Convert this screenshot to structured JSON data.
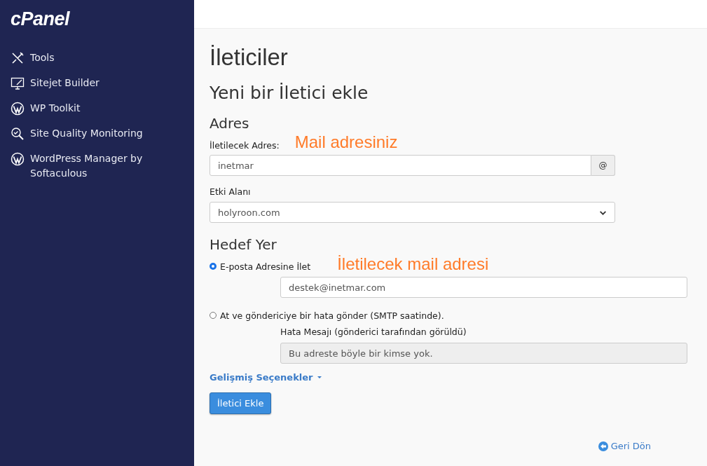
{
  "sidebar": {
    "logo": "cPanel",
    "items": [
      {
        "label": "Tools",
        "kind": "tools"
      },
      {
        "label": "Sitejet Builder",
        "kind": "builder"
      },
      {
        "label": "WP Toolkit",
        "kind": "wordpress"
      },
      {
        "label": "Site Quality Monitoring",
        "kind": "monitoring"
      },
      {
        "label": "WordPress Manager by Softaculous",
        "kind": "wordpress"
      }
    ]
  },
  "page": {
    "title": "İleticiler",
    "subtitle": "Yeni bir İletici ekle"
  },
  "address": {
    "heading": "Adres",
    "field_label": "İletilecek Adres:",
    "value": "inetmar",
    "addon": "@",
    "annotation": "Mail adresiniz",
    "domain_label": "Etki Alanı",
    "domain": "holyroon.com"
  },
  "destination": {
    "heading": "Hedef Yer",
    "annotation": "İletilecek mail adresi",
    "options": [
      {
        "label": "E-posta Adresine İlet",
        "selected": true,
        "kind": "input",
        "value": "destek@inetmar.com"
      },
      {
        "label": "At ve göndericiye bir hata gönder (SMTP saatinde).",
        "selected": false,
        "kind": "message",
        "field_label": "Hata Mesajı (gönderici tarafından görüldü)",
        "value": "Bu adreste böyle bir kimse yok."
      }
    ]
  },
  "advanced_link": "Gelişmiş Seçenekler",
  "submit_button": "İletici Ekle",
  "back_link": "Geri Dön"
}
